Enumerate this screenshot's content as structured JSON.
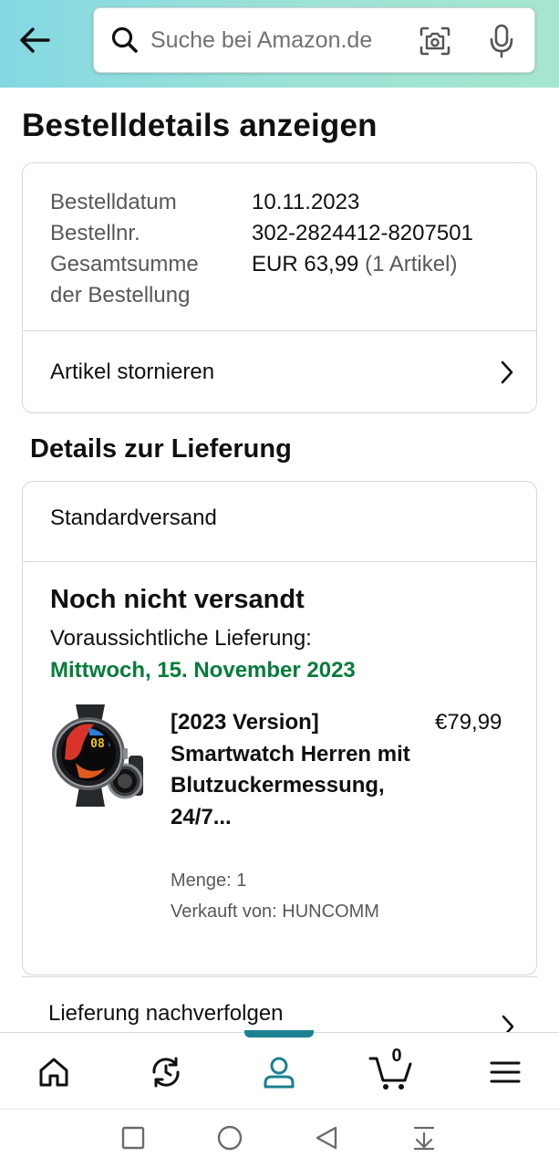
{
  "header": {
    "search_placeholder": "Suche bei Amazon.de",
    "back_icon": "arrow-left-icon",
    "search_icon": "search-icon",
    "camera_icon": "camera-icon",
    "mic_icon": "microphone-icon"
  },
  "page": {
    "title": "Bestelldetails anzeigen"
  },
  "order": {
    "date_label": "Bestelldatum",
    "date_value": "10.11.2023",
    "number_label": "Bestellnr.",
    "number_value": "302-2824412-8207501",
    "total_label_line1": "Gesamtsumme",
    "total_label_line2": "der Bestellung",
    "total_value": "EUR 63,99",
    "total_items": "(1 Artikel)",
    "cancel_label": "Artikel stornieren"
  },
  "delivery": {
    "section_title": "Details zur Lieferung",
    "shipping_method": "Standardversand",
    "status": "Noch nicht versandt",
    "eta_label": "Voraussichtliche Lieferung:",
    "eta_date": "Mittwoch, 15. November 2023",
    "eta_color": "#067d3b",
    "product": {
      "title": "[2023 Version] Smartwatch Herren mit Blutzuckermessung, 24/7...",
      "price": "€79,99",
      "quantity": "Menge: 1",
      "seller": "Verkauft von: HUNCOMM",
      "watch_display": "08"
    },
    "track_label": "Lieferung nachverfolgen"
  },
  "bottom_nav": {
    "items": [
      "home-icon",
      "history-icon",
      "account-icon",
      "cart-icon",
      "menu-icon"
    ],
    "active": "account-icon",
    "cart_count": "0",
    "accent": "#1b8190"
  },
  "system_nav": {
    "items": [
      "recents-square-icon",
      "home-circle-icon",
      "back-triangle-icon",
      "notification-pull-icon"
    ]
  }
}
